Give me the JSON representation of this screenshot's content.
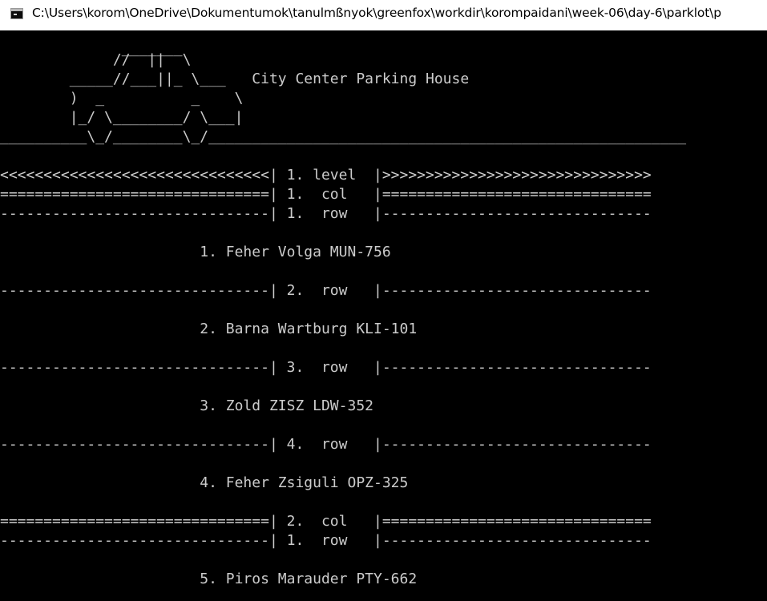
{
  "window": {
    "title": "C:\\Users\\korom\\OneDrive\\Dokumentumok\\tanulmßnyok\\greenfox\\workdir\\korompaidani\\week-06\\day-6\\parklot\\p"
  },
  "console": {
    "background": "#000000",
    "text_color": "#cccccc",
    "banner": [
      "              _______",
      "             //  ||  \\",
      "        _____//___||_ \\___   City Center Parking House",
      "        )  _          _    \\",
      "        |_/ \\________/ \\___|",
      "__________\\_/________\\_/_______________________________________________________"
    ],
    "lines": [
      "<<<<<<<<<<<<<<<<<<<<<<<<<<<<<<<| 1. level  |>>>>>>>>>>>>>>>>>>>>>>>>>>>>>>>",
      "===============================| 1.  col   |===============================",
      "-------------------------------| 1.  row   |-------------------------------",
      "",
      "                       1. Feher Volga MUN-756",
      "",
      "-------------------------------| 2.  row   |-------------------------------",
      "",
      "                       2. Barna Wartburg KLI-101",
      "",
      "-------------------------------| 3.  row   |-------------------------------",
      "",
      "                       3. Zold ZISZ LDW-352",
      "",
      "-------------------------------| 4.  row   |-------------------------------",
      "",
      "                       4. Feher Zsiguli OPZ-325",
      "",
      "===============================| 2.  col   |===============================",
      "-------------------------------| 1.  row   |-------------------------------",
      "",
      "                       5. Piros Marauder PTY-662"
    ]
  }
}
